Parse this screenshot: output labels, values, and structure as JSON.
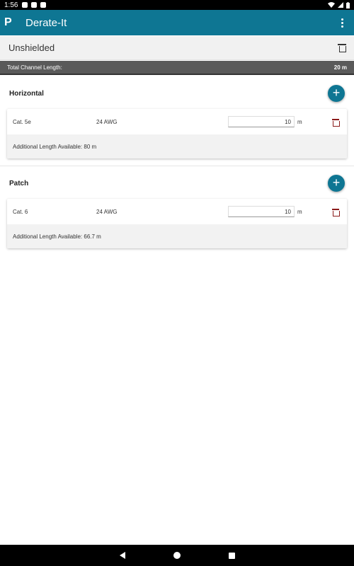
{
  "status": {
    "time": "1:56"
  },
  "app": {
    "title": "Derate-It",
    "logo": "P"
  },
  "header": {
    "title": "Unshielded"
  },
  "total": {
    "label": "Total Channel Length:",
    "value": "20 m"
  },
  "sections": [
    {
      "title": "Horizontal",
      "cable": {
        "category": "Cat. 5e",
        "gauge": "24 AWG",
        "length": "10",
        "unit": "m"
      },
      "additional": "Additional Length Available: 80 m"
    },
    {
      "title": "Patch",
      "cable": {
        "category": "Cat. 6",
        "gauge": "24 AWG",
        "length": "10",
        "unit": "m"
      },
      "additional": "Additional Length Available: 66.7 m"
    }
  ],
  "colors": {
    "accent": "#0e7693",
    "delete": "#8b1a1a",
    "total_bar": "#5a5a5a"
  },
  "icons": {
    "overflow": "more-vert-icon",
    "delete": "trash-icon",
    "add": "plus-icon",
    "nav": [
      "back-icon",
      "home-icon",
      "recents-icon"
    ]
  }
}
